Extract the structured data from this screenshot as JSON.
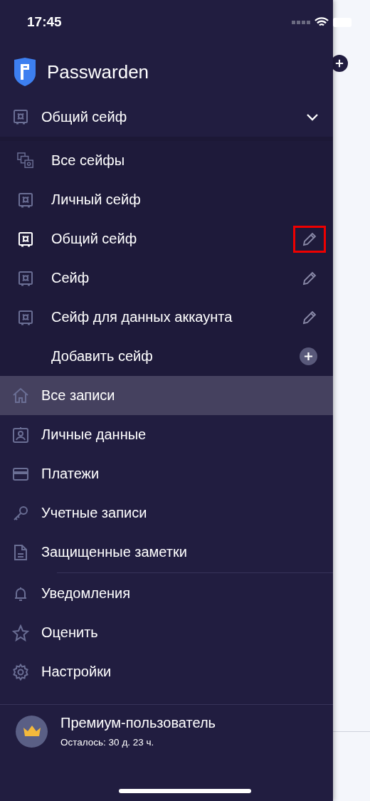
{
  "status_bar": {
    "time": "17:45"
  },
  "app": {
    "name": "Passwarden"
  },
  "current_vault": {
    "name": "Общий сейф",
    "expanded": true
  },
  "vaults": [
    {
      "kind": "all",
      "label": "Все сейфы",
      "selected": false,
      "editable": false
    },
    {
      "kind": "vault",
      "label": "Личный сейф",
      "selected": false,
      "editable": false
    },
    {
      "kind": "vault",
      "label": "Общий сейф",
      "selected": true,
      "editable": true,
      "highlighted": true
    },
    {
      "kind": "vault",
      "label": "Сейф",
      "selected": false,
      "editable": true,
      "highlighted": false
    },
    {
      "kind": "vault",
      "label": "Сейф для данных аккаунта",
      "selected": false,
      "editable": true,
      "highlighted": false
    },
    {
      "kind": "add",
      "label": "Добавить сейф",
      "selected": false,
      "editable": false
    }
  ],
  "nav_sections": [
    [
      {
        "kind": "home",
        "label": "Все записи",
        "selected": true
      },
      {
        "kind": "id",
        "label": "Личные данные",
        "selected": false
      },
      {
        "kind": "card",
        "label": "Платежи",
        "selected": false
      },
      {
        "kind": "key",
        "label": "Учетные записи",
        "selected": false
      },
      {
        "kind": "note",
        "label": "Защищенные заметки",
        "selected": false
      }
    ],
    [
      {
        "kind": "bell",
        "label": "Уведомления",
        "selected": false
      },
      {
        "kind": "star",
        "label": "Оценить",
        "selected": false
      },
      {
        "kind": "gear",
        "label": "Настройки",
        "selected": false
      }
    ]
  ],
  "premium": {
    "title": "Премиум-пользователь",
    "subtitle": "Осталось: 30 д. 23 ч."
  }
}
